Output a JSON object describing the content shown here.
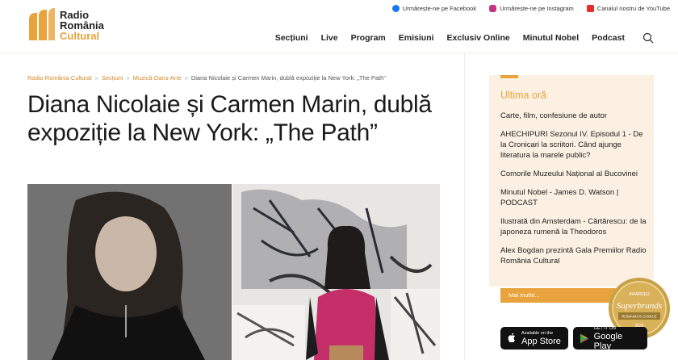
{
  "header": {
    "logo": {
      "line1": "Radio",
      "line2": "România",
      "line3": "Cultural"
    },
    "social": [
      {
        "label": "Urmărește-ne pe Facebook",
        "icon": "facebook-icon",
        "color": "#1877f2"
      },
      {
        "label": "Urmărește-ne pe Instagram",
        "icon": "instagram-icon",
        "color": "#c13584"
      },
      {
        "label": "Canalul nostru de YouTube",
        "icon": "youtube-icon",
        "color": "#e52d27"
      }
    ],
    "nav": [
      "Secțiuni",
      "Live",
      "Program",
      "Emisiuni",
      "Exclusiv Online",
      "Minutul Nobel",
      "Podcast"
    ]
  },
  "breadcrumb": [
    "Radio România Cultural",
    "Secțiuni",
    "Muzică-Dans-Arte",
    "Diana Nicolaie și Carmen Marin, dublă expoziție la New York: „The Path”"
  ],
  "article": {
    "title": "Diana Nicolaie și Carmen Marin, dublă expoziție la New York: „The Path”"
  },
  "sidebar": {
    "title": "Ultima oră",
    "items": [
      "Carte, film, confesiune de autor",
      "AHECHIPURI Sezonul IV. Episodul 1 - De la Cronicari la scriitori. Când ajunge literatura la marele public?",
      "Comorile Muzeului Național al Bucovinei",
      "Minutul Nobel - James D. Watson | PODCAST",
      "Ilustrată din Amsterdam - Cărtărescu: de la japoneza rumenă la Theodoros",
      "Alex Bogdan prezintă Gala Premiilor Radio România Cultural"
    ],
    "more": "Mai multe..."
  },
  "badge": {
    "top": "AWARDED",
    "name": "Superbrands",
    "sub": "ROMANIA'S CHOICE",
    "year": "2024"
  },
  "stores": {
    "app": {
      "small": "Available on the",
      "big": "App Store"
    },
    "gp": {
      "small": "GET IT ON",
      "big": "Google Play"
    }
  },
  "colors": {
    "accent": "#e8a33c",
    "sidebar_bg": "#fbf0e2"
  }
}
